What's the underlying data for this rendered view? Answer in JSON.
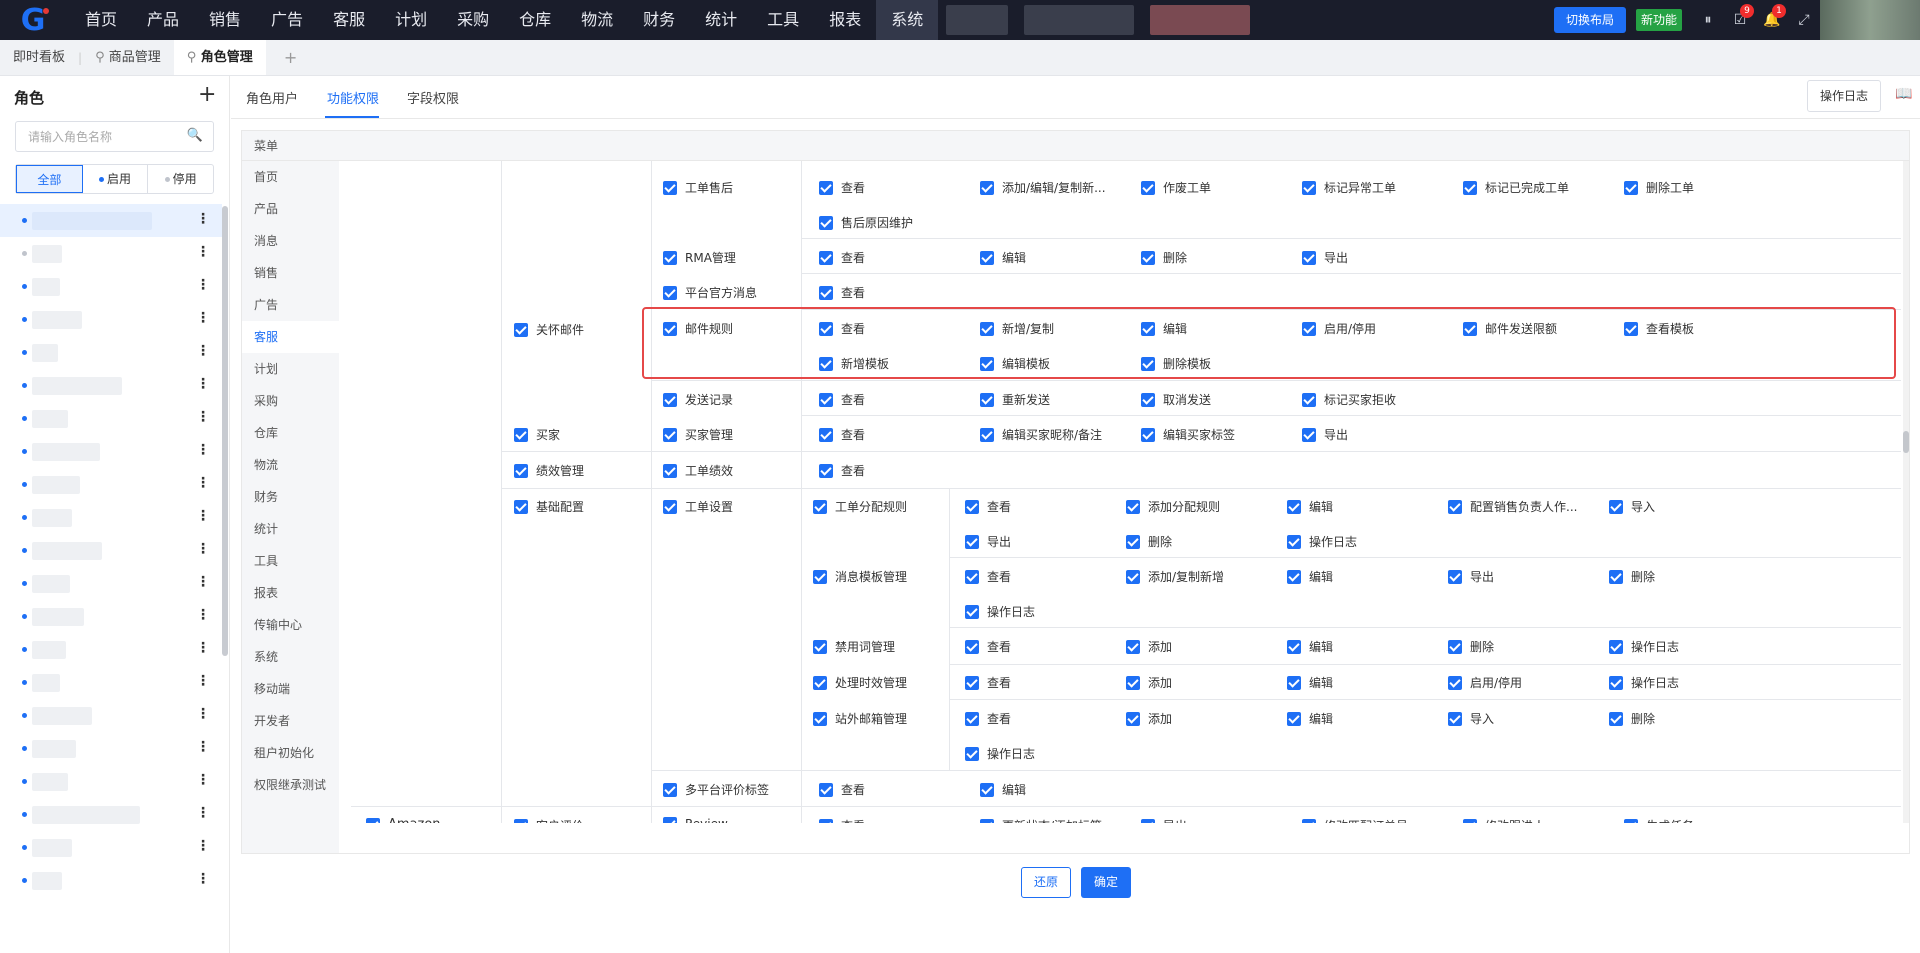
{
  "topnav": {
    "items": [
      "首页",
      "产品",
      "销售",
      "广告",
      "客服",
      "计划",
      "采购",
      "仓库",
      "物流",
      "财务",
      "统计",
      "工具",
      "报表",
      "系统"
    ],
    "active_index": 13,
    "switch_layout": "切换布局",
    "new_feature": "新功能",
    "tasks_badge": "9",
    "notify_badge": "1"
  },
  "tabs": {
    "items": [
      "即时看板",
      "商品管理",
      "角色管理"
    ],
    "active_index": 2
  },
  "sidebar": {
    "title": "角色",
    "search_placeholder": "请输入角色名称",
    "filters": [
      "全部",
      "启用",
      "停用"
    ],
    "active_filter": 0
  },
  "content": {
    "tabs": [
      "角色用户",
      "功能权限",
      "字段权限"
    ],
    "active_tab": 1,
    "log_button": "操作日志",
    "menu_header": "菜单",
    "menu": [
      "首页",
      "产品",
      "消息",
      "销售",
      "广告",
      "客服",
      "计划",
      "采购",
      "仓库",
      "物流",
      "财务",
      "统计",
      "工具",
      "报表",
      "传输中心",
      "系统",
      "移动端",
      "开发者",
      "租户初始化",
      "权限继承测试"
    ],
    "active_menu": 5,
    "permissions": {
      "r1_group": "工单售后",
      "r1_perms": [
        "查看",
        "添加/编辑/复制新...",
        "作废工单",
        "标记异常工单",
        "标记已完成工单",
        "删除工单",
        "售后原因维护"
      ],
      "r2_group": "RMA管理",
      "r2_perms": [
        "查看",
        "编辑",
        "删除",
        "导出"
      ],
      "r3_group": "平台官方消息",
      "r3_perms": [
        "查看"
      ],
      "care_mail": "关怀邮件",
      "r4_group": "邮件规则",
      "r4_perms": [
        "查看",
        "新增/复制",
        "编辑",
        "启用/停用",
        "邮件发送限额",
        "查看模板",
        "新增模板",
        "编辑模板",
        "删除模板"
      ],
      "r5_group": "发送记录",
      "r5_perms": [
        "查看",
        "重新发送",
        "取消发送",
        "标记买家拒收"
      ],
      "buyer": "买家",
      "r6_group": "买家管理",
      "r6_perms": [
        "查看",
        "编辑买家昵称/备注",
        "编辑买家标签",
        "导出"
      ],
      "performance": "绩效管理",
      "r7_group": "工单绩效",
      "r7_perms": [
        "查看"
      ],
      "basic_config": "基础配置",
      "ticket_settings": "工单设置",
      "s1_name": "工单分配规则",
      "s1_perms": [
        "查看",
        "添加分配规则",
        "编辑",
        "配置销售负责人作...",
        "导入",
        "导出",
        "删除",
        "操作日志"
      ],
      "s2_name": "消息模板管理",
      "s2_perms": [
        "查看",
        "添加/复制新增",
        "编辑",
        "导出",
        "删除",
        "操作日志"
      ],
      "s3_name": "禁用词管理",
      "s3_perms": [
        "查看",
        "添加",
        "编辑",
        "删除",
        "操作日志"
      ],
      "s4_name": "处理时效管理",
      "s4_perms": [
        "查看",
        "添加",
        "编辑",
        "启用/停用",
        "操作日志"
      ],
      "s5_name": "站外邮箱管理",
      "s5_perms": [
        "查看",
        "添加",
        "编辑",
        "导入",
        "删除",
        "操作日志"
      ],
      "r8_group": "多平台评价标签",
      "r8_perms": [
        "查看",
        "编辑"
      ],
      "amazon": "Amazon",
      "customer_review": "客户评价",
      "r9_group": "Review",
      "r9_perms": [
        "查看",
        "更新状态/添加标签",
        "导出",
        "修改匹配订单号",
        "修改跟进人",
        "生成任务"
      ]
    }
  },
  "footer": {
    "reset": "还原",
    "confirm": "确定"
  }
}
